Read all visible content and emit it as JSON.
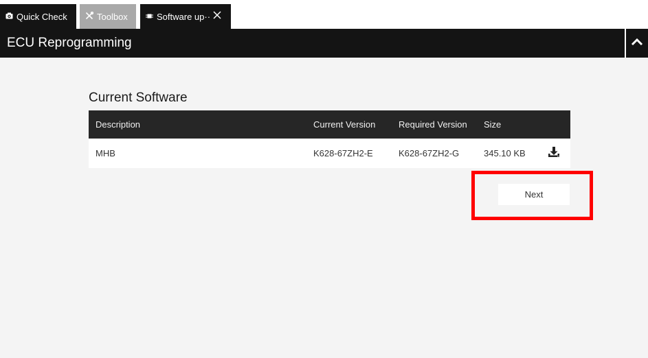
{
  "tabs": {
    "quick_check": "Quick Check",
    "toolbox": "Toolbox",
    "software_update": "Software up··"
  },
  "header": {
    "title": "ECU Reprogramming"
  },
  "main": {
    "section_title": "Current Software",
    "columns": [
      "Description",
      "Current Version",
      "Required Version",
      "Size"
    ],
    "rows": [
      {
        "description": "MHB",
        "current_version": "K628-67ZH2-E",
        "required_version": "K628-67ZH2-G",
        "size": "345.10 KB",
        "action_icon": "download-icon"
      }
    ],
    "next_label": "Next"
  },
  "colors": {
    "tab_dark": "#141414",
    "tab_inactive": "#a9a9a9",
    "header": "#141414",
    "table_header": "#262626",
    "content_bg": "#f4f4f4",
    "highlight": "#ff0000"
  }
}
